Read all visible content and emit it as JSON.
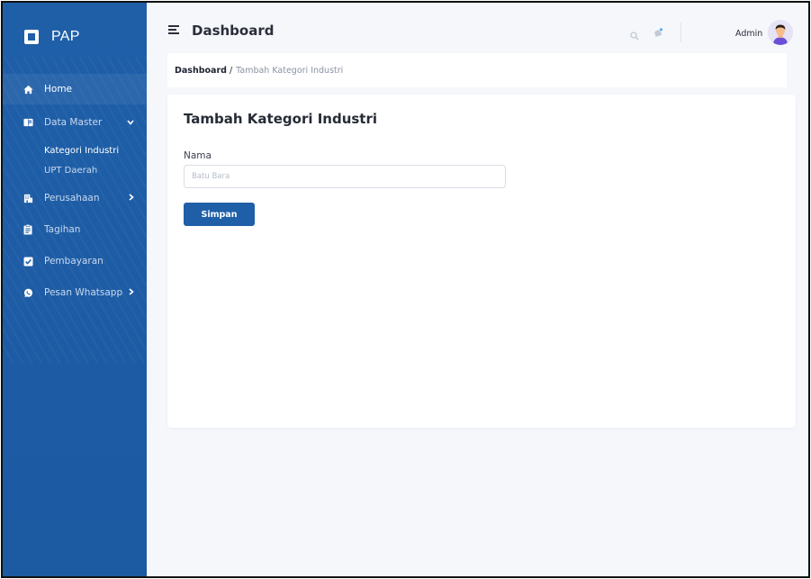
{
  "brand": {
    "name": "PAP"
  },
  "sidebar": {
    "items": [
      {
        "label": "Home",
        "icon": "home-icon"
      },
      {
        "label": "Data Master",
        "icon": "book-icon"
      },
      {
        "label": "Perusahaan",
        "icon": "building-icon"
      },
      {
        "label": "Tagihan",
        "icon": "clipboard-icon"
      },
      {
        "label": "Pembayaran",
        "icon": "check-square-icon"
      },
      {
        "label": "Pesan Whatsapp",
        "icon": "whatsapp-icon"
      }
    ],
    "sub_items": [
      {
        "label": "Kategori Industri"
      },
      {
        "label": "UPT Daerah"
      }
    ]
  },
  "header": {
    "title": "Dashboard",
    "user_name": "Admin"
  },
  "breadcrumb": {
    "home": "Dashboard",
    "separator": "/",
    "current": "Tambah Kategori Industri"
  },
  "form": {
    "title": "Tambah Kategori Industri",
    "nama_label": "Nama",
    "nama_placeholder": "Batu Bara",
    "nama_value": "",
    "submit_label": "Simpan"
  },
  "colors": {
    "primary": "#1f5fa8",
    "background": "#f5f7fb",
    "card": "#ffffff"
  }
}
